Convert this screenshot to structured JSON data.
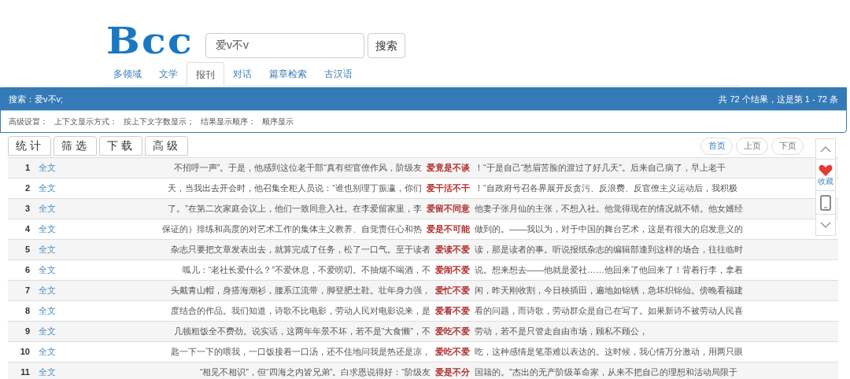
{
  "logo": {
    "text": "Bcc"
  },
  "search": {
    "value": "爱v不v",
    "button": "搜索"
  },
  "tabs": [
    {
      "label": "多领域",
      "selected": false
    },
    {
      "label": "文学",
      "selected": false
    },
    {
      "label": "报刊",
      "selected": true
    },
    {
      "label": "对话",
      "selected": false
    },
    {
      "label": "篇章检索",
      "selected": false
    },
    {
      "label": "古汉语",
      "selected": false
    }
  ],
  "result_bar": {
    "query": "搜索：爱v不v;",
    "summary": "共 72 个结果，这是第 1 - 72 条"
  },
  "settings": [
    "高级设置：",
    "上下文显示方式：",
    "按上下文字数显示；",
    "结果显示顺序：",
    "顺序显示"
  ],
  "toolbar": [
    "统计",
    "筛选",
    "下载",
    "高级"
  ],
  "pagination": [
    "首页",
    "上页",
    "下页"
  ],
  "side_panel": {
    "favorite_label": "收藏"
  },
  "rows": [
    {
      "num": "1",
      "link": "全文",
      "left": "不招呼一声”。于是，他感到这位老干部“真有些官僚作风，阶级友",
      "keyword": "爱竟是不谈",
      "right": "！“于是自己“愁眉苦脸的渡过了好几天”。后来自己病了，早上老干"
    },
    {
      "num": "2",
      "link": "全文",
      "left": "天，当我出去开会时，他召集全柜人员说：“谁也别理丁振瀛，你们",
      "keyword": "爱干活不干",
      "right": "！“自政府号召各界展开反贪污、反浪费、反官僚主义运动后，我积极"
    },
    {
      "num": "3",
      "link": "全文",
      "left": "了。”在第二次家庭会议上，他们一致同意入社。在李爱留家里，李",
      "keyword": "爱留不同意",
      "right": "他妻子张月仙的主张，不想入社。他觉得现在的情况就不错。他女婿经"
    },
    {
      "num": "4",
      "link": "全文",
      "left": "保证的）排练和高度的对艺术工作的集体主义教养、自觉责任心和热",
      "keyword": "爱是不可能",
      "right": "做到的。——我以为，对于中国的舞台艺术，这是有很大的启发意义的"
    },
    {
      "num": "5",
      "link": "全文",
      "left": "杂志只要把文章发表出去，就算完成了任务，松了一口气。至于读者",
      "keyword": "爱读不爱",
      "right": "读，那是读者的事。听说报纸杂志的编辑部逢到这样的场合，往往临时"
    },
    {
      "num": "6",
      "link": "全文",
      "left": "呱儿：“老社长爱什么？”不爱休息，不爱唠叨。不抽烟不喝酒，不",
      "keyword": "爱闹不爱",
      "right": "说。想来想去——他就是爱社……他回来了他回来了！背着行李，拿着"
    },
    {
      "num": "7",
      "link": "全文",
      "left": "头戴青山帽，身搭海潮衫，腰系江流带，脚登肥土鞋。壮年身力强，",
      "keyword": "爱忙不爱",
      "right": "闲，昨天刚收割，今日秧插田，遍地如锦锈，急坏织锦仙。傍晚看福建"
    },
    {
      "num": "8",
      "link": "全文",
      "left": "度结合的作品。我们知道，诗歌不比电影，劳动人民对电影说来，是",
      "keyword": "爱看不爱",
      "right": "看的问题，而诗歌，劳动群众是自己在写了。如果新诗不被劳动人民喜"
    },
    {
      "num": "9",
      "link": "全文",
      "left": "几顿粗饭全不费劲。说实话，这两年年景不坏，若不是“大食懒”，不",
      "keyword": "爱吃不爱",
      "right": "劳动，若不是只管走自由市场，顾私不顾公，"
    },
    {
      "num": "10",
      "link": "全文",
      "left": "匙一下一下的喂我，一口饭接着一口汤，还不住地问我是热还是凉，",
      "keyword": "爱吃不爱",
      "right": "吃，这种感情是笔墨难以表达的。这时候，我心情万分激动，用两只眼"
    },
    {
      "num": "11",
      "link": "全文",
      "left": "“相见不相识”，但“四海之内皆兄弟”。白求恩说得好：“阶级友",
      "keyword": "爱是不分",
      "right": "国籍的。”杰出的无产阶级革命家，从来不把自己的理想和活动局限于"
    }
  ]
}
